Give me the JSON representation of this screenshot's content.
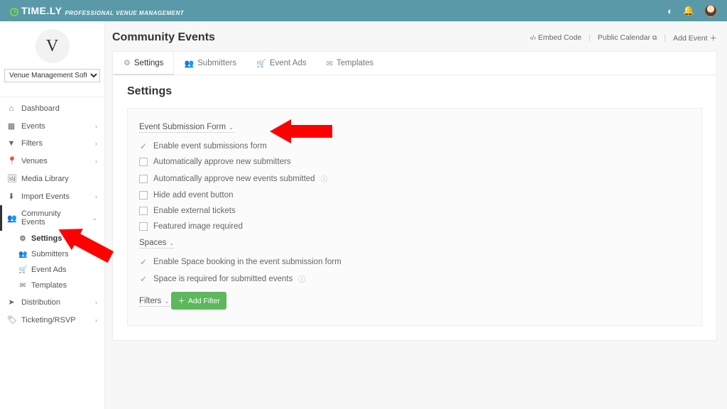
{
  "brand": {
    "name": "TIME.LY",
    "tagline": "PROFESSIONAL VENUE MANAGEMENT"
  },
  "venue_selector": {
    "value": "Venue Management Software"
  },
  "sidebar": {
    "avatar_initial": "V",
    "items": [
      {
        "icon": "⌂",
        "label": "Dashboard"
      },
      {
        "icon": "▦",
        "label": "Events",
        "expandable": true
      },
      {
        "icon": "▼",
        "label": "Filters",
        "expandable": true
      },
      {
        "icon": "📍",
        "label": "Venues",
        "expandable": true
      },
      {
        "icon": "🖼",
        "label": "Media Library"
      },
      {
        "icon": "⬇",
        "label": "Import Events",
        "expandable": true
      },
      {
        "icon": "👥",
        "label": "Community Events",
        "expandable": true,
        "open": true
      },
      {
        "icon": "➤",
        "label": "Distribution",
        "expandable": true
      },
      {
        "icon": "🏷",
        "label": "Ticketing/RSVP",
        "expandable": true
      }
    ],
    "community_sub": [
      {
        "icon": "⚙",
        "label": "Settings",
        "selected": true
      },
      {
        "icon": "👥",
        "label": "Submitters"
      },
      {
        "icon": "🛒",
        "label": "Event Ads"
      },
      {
        "icon": "✉",
        "label": "Templates"
      }
    ]
  },
  "page": {
    "title": "Community Events",
    "actions": {
      "embed": "Embed Code",
      "calendar": "Public Calendar",
      "add": "Add Event"
    }
  },
  "tabs": [
    {
      "icon": "⚙",
      "label": "Settings"
    },
    {
      "icon": "👥",
      "label": "Submitters"
    },
    {
      "icon": "🛒",
      "label": "Event Ads"
    },
    {
      "icon": "✉",
      "label": "Templates"
    }
  ],
  "settings": {
    "heading": "Settings",
    "section1": "Event Submission Form",
    "opts1": [
      {
        "type": "on",
        "label": "Enable event submissions form"
      },
      {
        "type": "off",
        "label": "Automatically approve new submitters"
      },
      {
        "type": "off",
        "label": "Automatically approve new events submitted",
        "info": true
      },
      {
        "type": "off",
        "label": "Hide add event button"
      },
      {
        "type": "off",
        "label": "Enable external tickets"
      },
      {
        "type": "off",
        "label": "Featured image required"
      }
    ],
    "section2": "Spaces",
    "opts2": [
      {
        "type": "on",
        "label": "Enable Space booking in the event submission form"
      },
      {
        "type": "on",
        "label": "Space is required for submitted events",
        "info": true
      }
    ],
    "section3": "Filters",
    "add_filter": "Add Filter"
  }
}
